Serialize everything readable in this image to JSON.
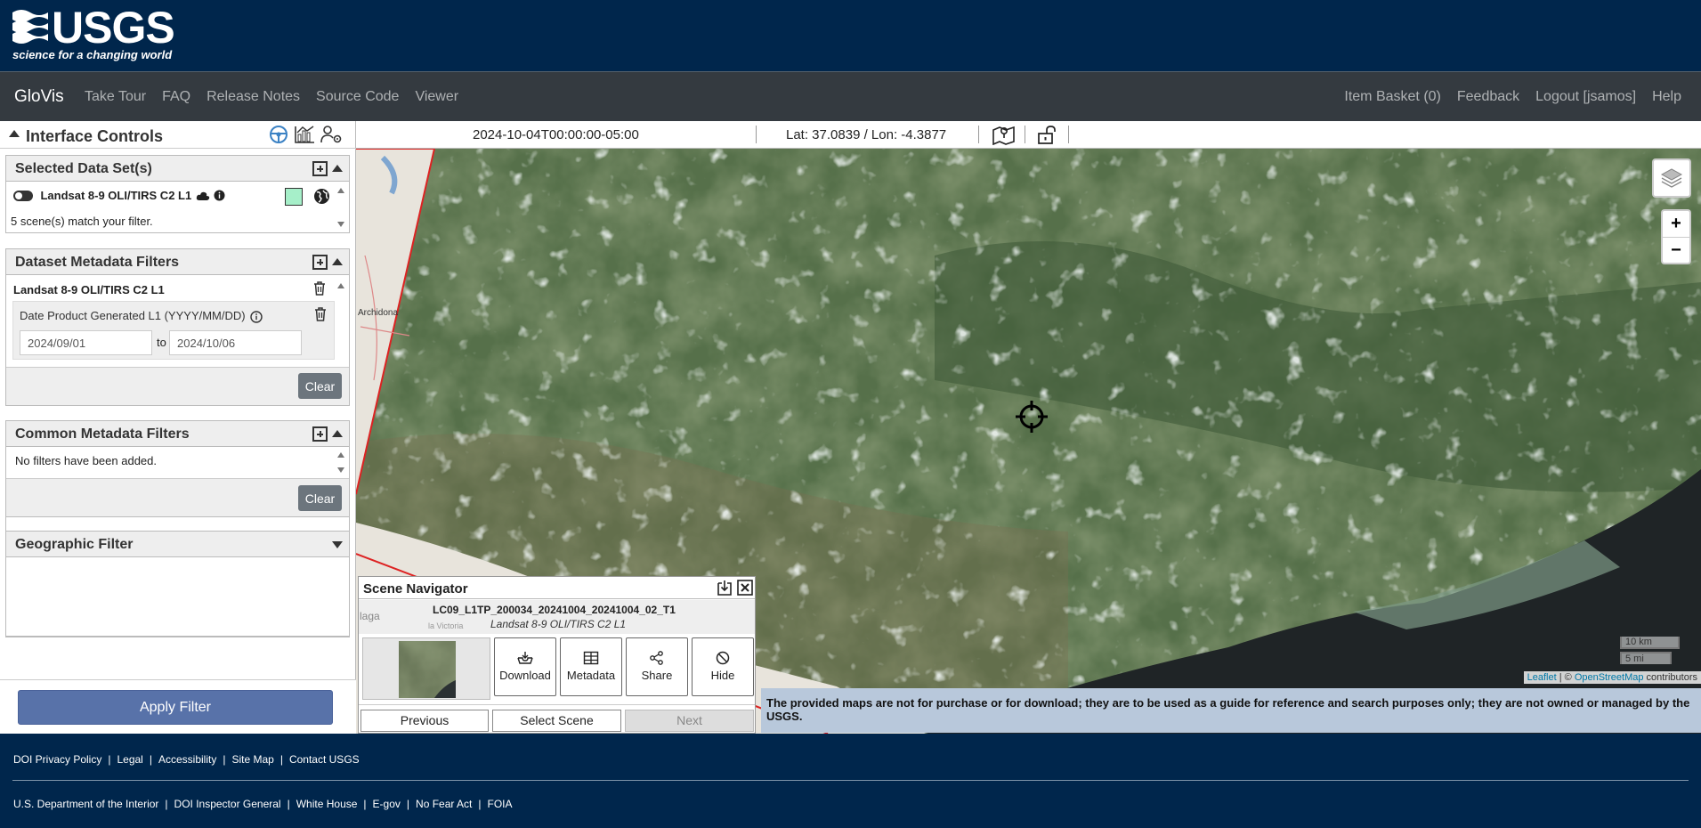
{
  "header": {
    "logo_text": "USGS",
    "tagline": "science for a changing world"
  },
  "nav": {
    "brand": "GloVis",
    "left_links": [
      "Take Tour",
      "FAQ",
      "Release Notes",
      "Source Code",
      "Viewer"
    ],
    "right_links": [
      "Item Basket (0)",
      "Feedback",
      "Logout [jsamos]",
      "Help"
    ]
  },
  "interface_controls": {
    "title": "Interface Controls",
    "icons": [
      "steering-wheel-icon",
      "chart-icon",
      "user-settings-icon"
    ]
  },
  "selected_datasets": {
    "title": "Selected Data Set(s)",
    "dataset_name": "Landsat 8-9 OLI/TIRS C2 L1",
    "dataset_color": "#a6efc9",
    "match_text": "5 scene(s) match your filter."
  },
  "dataset_metadata_filters": {
    "title": "Dataset Metadata Filters",
    "dataset_label": "Landsat 8-9 OLI/TIRS C2 L1",
    "filter_label": "Date Product Generated L1 (YYYY/MM/DD)",
    "from_value": "2024/09/01",
    "to_label": "to",
    "to_value": "2024/10/06",
    "clear_label": "Clear"
  },
  "common_metadata_filters": {
    "title": "Common Metadata Filters",
    "empty_text": "No filters have been added.",
    "clear_label": "Clear"
  },
  "geographic_filter": {
    "title": "Geographic Filter"
  },
  "apply_filter_label": "Apply Filter",
  "statusbar": {
    "datetime": "2024-10-04T00:00:00-05:00",
    "latlon": "Lat: 37.0839 / Lon: -4.3877"
  },
  "map": {
    "place_label_1": "Archidona",
    "place_label_2": "laga",
    "place_label_3": "la Victoria",
    "scale_km": "10 km",
    "scale_mi": "5 mi",
    "attribution_leaflet": "Leaflet",
    "attribution_sep": " | © ",
    "attribution_osm": "OpenStreetMap",
    "attribution_tail": " contributors",
    "disclaimer": "The provided maps are not for purchase or for download; they are to be used as a guide for reference and search purposes only; they are not owned or managed by the USGS."
  },
  "scene_navigator": {
    "title": "Scene Navigator",
    "scene_id": "LC09_L1TP_200034_20241004_20241004_02_T1",
    "dataset": "Landsat 8-9 OLI/TIRS C2 L1",
    "buttons": [
      "Download",
      "Metadata",
      "Share",
      "Hide"
    ],
    "previous_label": "Previous",
    "select_label": "Select Scene",
    "next_label": "Next"
  },
  "footer": {
    "row1": [
      "DOI Privacy Policy",
      "Legal",
      "Accessibility",
      "Site Map",
      "Contact USGS"
    ],
    "row2": [
      "U.S. Department of the Interior",
      "DOI Inspector General",
      "White House",
      "E-gov",
      "No Fear Act",
      "FOIA"
    ]
  }
}
